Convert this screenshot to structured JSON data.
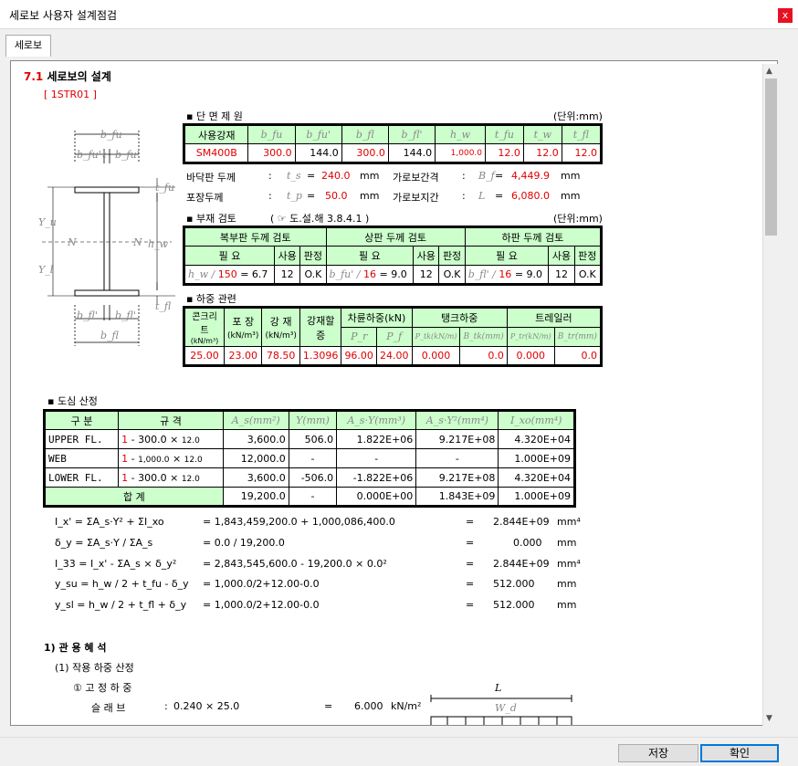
{
  "window": {
    "title": "세로보 사용자 설계점검",
    "close_label": "x"
  },
  "tab": {
    "label": "세로보"
  },
  "doc": {
    "heading_num": "7.1",
    "heading_text": "세로보의 설계",
    "member_id": "[ 1STR01 ]",
    "section": {
      "label": "▪ 단 면 제 원",
      "unit": "(단위:mm)",
      "headers": [
        "사용강재",
        "b_fu",
        "b_fu'",
        "b_fl",
        "b_fl'",
        "h_w",
        "t_fu",
        "t_w",
        "t_fl"
      ],
      "values": [
        "SM400B",
        "300.0",
        "144.0",
        "300.0",
        "144.0",
        "1,000.0",
        "12.0",
        "12.0",
        "12.0"
      ],
      "rows": [
        {
          "label": "바닥판 두께",
          "colon": ":",
          "sym": "t_s",
          "eq": "=",
          "val": "240.0",
          "unit": "mm",
          "label2": "가로보간격",
          "colon2": ":",
          "sym2": "B_f",
          "eq2": "=",
          "val2": "4,449.9",
          "unit2": "mm"
        },
        {
          "label": "포장두께",
          "colon": ":",
          "sym": "t_p",
          "eq": "=",
          "val": "50.0",
          "unit": "mm",
          "label2": "가로보지간",
          "colon2": ":",
          "sym2": "L",
          "eq2": "=",
          "val2": "6,080.0",
          "unit2": "mm"
        }
      ]
    },
    "thickness": {
      "label": "▪ 부재 검토",
      "ref": "( ☞ 도.설.해 3.8.4.1 )",
      "unit": "(단위:mm)",
      "groups": [
        "복부판 두께 검토",
        "상판 두께 검토",
        "하판 두께 검토"
      ],
      "subheaders": [
        "필 요",
        "사용",
        "판정",
        "필 요",
        "사용",
        "판정",
        "필 요",
        "사용",
        "판정"
      ],
      "cells": [
        {
          "sym": "h_w /",
          "div": "150",
          "res": "= 6.7",
          "use": "12",
          "judge": "O.K"
        },
        {
          "sym": "b_fu' /",
          "div": "16",
          "res": "= 9.0",
          "use": "12",
          "judge": "O.K"
        },
        {
          "sym": "b_fl' /",
          "div": "16",
          "res": "= 9.0",
          "use": "12",
          "judge": "O.K"
        }
      ]
    },
    "load": {
      "label": "▪ 하중 관련",
      "headers": [
        "콘크리트",
        "포 장",
        "강 재",
        "강재할증",
        "차륜하중(kN)",
        "탱크하중",
        "트레일러"
      ],
      "units": [
        "(kN/m³)",
        "(kN/m³)",
        "(kN/m³)"
      ],
      "subheaders": [
        "P_r",
        "P_f",
        "P_tk(kN/m)",
        "B_tk(mm)",
        "P_tr(kN/m)",
        "B_tr(mm)"
      ],
      "values": [
        "25.00",
        "23.00",
        "78.50",
        "1.3096",
        "96.00",
        "24.00",
        "0.000",
        "0.0",
        "0.000",
        "0.0"
      ]
    },
    "centroid": {
      "label": "▪ 도심 산정",
      "headers": [
        "구 분",
        "규     격",
        "A_s(mm²)",
        "Y(mm)",
        "A_s·Y(mm³)",
        "A_s·Y²(mm⁴)",
        "I_xo(mm⁴)"
      ],
      "rows": [
        {
          "name": "UPPER FL.",
          "n": "1",
          "dash": "-",
          "spec1": "300.0",
          "x": "×",
          "spec2": "12.0",
          "As": "3,600.0",
          "Y": "506.0",
          "AsY": "1.822E+06",
          "AsY2": "9.217E+08",
          "Ixo": "4.320E+04"
        },
        {
          "name": "WEB",
          "n": "1",
          "dash": "-",
          "spec1": "1,000.0",
          "x": "×",
          "spec2": "12.0",
          "As": "12,000.0",
          "Y": "-",
          "AsY": "-",
          "AsY2": "-",
          "Ixo": "1.000E+09"
        },
        {
          "name": "LOWER FL.",
          "n": "1",
          "dash": "-",
          "spec1": "300.0",
          "x": "×",
          "spec2": "12.0",
          "As": "3,600.0",
          "Y": "-506.0",
          "AsY": "-1.822E+06",
          "AsY2": "9.217E+08",
          "Ixo": "4.320E+04"
        }
      ],
      "total": {
        "label": "합      계",
        "As": "19,200.0",
        "Y": "-",
        "AsY": "0.000E+00",
        "AsY2": "1.843E+09",
        "Ixo": "1.000E+09"
      }
    },
    "formulas": [
      {
        "lhs": "I_x' = ΣA_s·Y² + ΣI_xo",
        "mid": "= 1,843,459,200.0 + 1,000,086,400.0",
        "eq": "=",
        "res": "2.844E+09",
        "unit": "mm⁴"
      },
      {
        "lhs": "δ_y = ΣA_s·Y / ΣA_s",
        "mid": "= 0.0 / 19,200.0",
        "eq": "=",
        "res": "0.000",
        "unit": "mm"
      },
      {
        "lhs": "I_33 = I_x' - ΣA_s × δ_y²",
        "mid": "= 2,843,545,600.0 - 19,200.0 × 0.0²",
        "eq": "=",
        "res": "2.844E+09",
        "unit": "mm⁴"
      },
      {
        "lhs": "y_su = h_w / 2 + t_fu - δ_y",
        "mid": "= 1,000.0/2+12.00-0.0",
        "eq": "=",
        "res": "512.000",
        "unit": "mm"
      },
      {
        "lhs": "y_sl = h_w / 2 + t_fl + δ_y",
        "mid": "= 1,000.0/2+12.00-0.0",
        "eq": "=",
        "res": "512.000",
        "unit": "mm"
      }
    ],
    "sec1": "1) 관 용 혜 석",
    "sec1_sub": "(1) 작용 하중 산정",
    "sec1_item": "① 고 정 하 중",
    "slab": {
      "label": "슬 래 브",
      "colon": ":",
      "expr": "0.240 × 25.0",
      "eq": "=",
      "val": "6.000",
      "unit": "kN/m²"
    },
    "beam_label": "L",
    "beam_w": "W_d",
    "diagram": {
      "bfu": "b_fu",
      "bfu_half1": "b_fu'",
      "t": "t",
      "bfu_half2": "b_fu'",
      "tfu": "t_fu",
      "yu": "Y_u",
      "yl": "Y_l",
      "N1": "N",
      "N2": "N",
      "hw": "h_w",
      "tfl": "t_fl",
      "bfl_half1": "b_fl'",
      "bfl_half2": "b_fl'",
      "bfl": "b_fl"
    }
  },
  "buttons": {
    "save": "저장",
    "ok": "확인"
  }
}
